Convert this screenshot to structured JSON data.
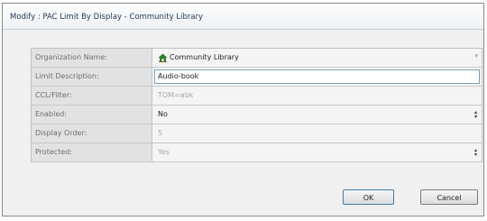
{
  "window": {
    "title": "Modify : PAC Limit By Display - Community Library"
  },
  "form": {
    "rows": [
      {
        "label": "Organization Name:",
        "value": "Community Library"
      },
      {
        "label": "Limit Description:",
        "value": "Audio-book"
      },
      {
        "label": "CCL/Filter:",
        "value": "TOM=abk"
      },
      {
        "label": "Enabled:",
        "value": "No"
      },
      {
        "label": "Display Order:",
        "value": "5"
      },
      {
        "label": "Protected:",
        "value": "Yes"
      }
    ]
  },
  "buttons": {
    "ok": "OK",
    "cancel": "Cancel"
  },
  "icons": {
    "organization": "home-icon",
    "dropdown": "chevron-down-icon",
    "spinner": "spinner-arrows-icon"
  },
  "colors": {
    "title_text": "#2a3a56",
    "home_icon": "#2f7d2f",
    "input_border": "#7f9db9"
  }
}
